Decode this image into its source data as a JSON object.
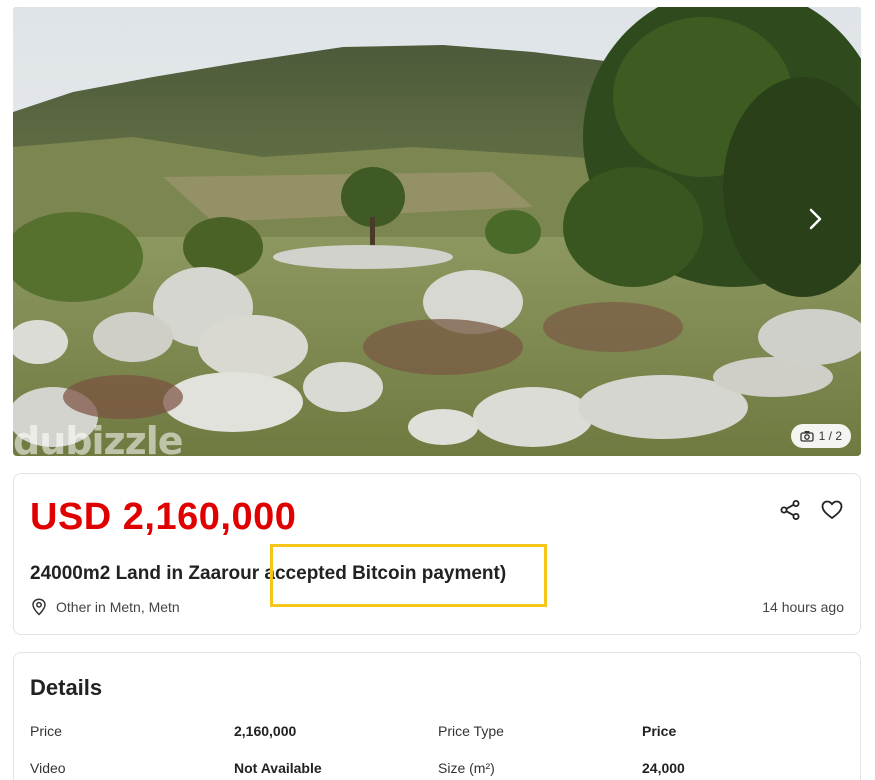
{
  "gallery": {
    "watermark": "dubizzle",
    "counter": "1 / 2",
    "icons": {
      "next": "chevron-right-icon",
      "camera": "camera-icon"
    }
  },
  "listing": {
    "price": "USD 2,160,000",
    "title": "24000m2 Land in Zaarour accepted Bitcoin payment)",
    "location": "Other in Metn, Metn",
    "posted": "14 hours ago",
    "icons": {
      "share": "share-icon",
      "favorite": "heart-icon",
      "location": "location-pin-icon"
    },
    "accent_color": "#e00000"
  },
  "highlight": {
    "color": "#f5c518"
  },
  "details": {
    "title": "Details",
    "rows": [
      {
        "label": "Price",
        "value": "2,160,000"
      },
      {
        "label": "Price Type",
        "value": "Price"
      },
      {
        "label": "Video",
        "value": "Not Available"
      },
      {
        "label": "Size (m²)",
        "value": "24,000"
      }
    ]
  }
}
